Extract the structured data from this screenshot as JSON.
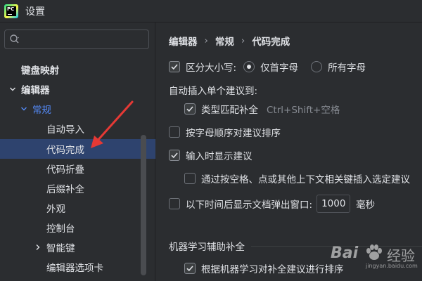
{
  "window": {
    "title": "设置"
  },
  "sidebar": {
    "search": {
      "value": "",
      "placeholder": ""
    },
    "items": [
      {
        "label": "键盘映射",
        "level": 0,
        "expanded": null
      },
      {
        "label": "编辑器",
        "level": 0,
        "expanded": true
      },
      {
        "label": "常规",
        "level": 1,
        "expanded": true
      },
      {
        "label": "自动导入",
        "level": 2
      },
      {
        "label": "代码完成",
        "level": 2,
        "selected": true
      },
      {
        "label": "代码折叠",
        "level": 2
      },
      {
        "label": "后缀补全",
        "level": 2
      },
      {
        "label": "外观",
        "level": 2
      },
      {
        "label": "控制台",
        "level": 2
      },
      {
        "label": "智能键",
        "level": 2,
        "expanded": false
      },
      {
        "label": "编辑器选项卡",
        "level": 2
      }
    ]
  },
  "main": {
    "breadcrumb": [
      "编辑器",
      "常规",
      "代码完成"
    ],
    "case_sensitive": {
      "label": "区分大小写:",
      "checked": true
    },
    "case_options": [
      {
        "label": "仅首字母",
        "checked": true
      },
      {
        "label": "所有字母",
        "checked": false
      }
    ],
    "auto_insert_label": "自动插入单个建议到:",
    "type_match": {
      "label": "类型匹配补全",
      "checked": true,
      "shortcut": "Ctrl+Shift+空格"
    },
    "sort_alpha": {
      "label": "按字母顺序对建议排序",
      "checked": false
    },
    "show_on_typing": {
      "label": "输入时显示建议",
      "checked": true
    },
    "insert_by_space": {
      "label": "通过按空格、点或其他上下文相关键插入选定建议",
      "checked": false
    },
    "doc_popup": {
      "label": "以下时间后显示文档弹出窗口:",
      "checked": false,
      "value": "1000",
      "unit": "毫秒"
    },
    "ml_section": "机器学习辅助补全",
    "ml_sort": {
      "label": "根据机器学习对补全建议进行排序",
      "checked": true
    }
  },
  "watermark": {
    "brand": "Bai",
    "brand2": "经验",
    "url": "jingyan.baidu.com"
  },
  "colors": {
    "accent": "#548af7",
    "selection": "#2e436e",
    "annotation": "#e53935"
  }
}
